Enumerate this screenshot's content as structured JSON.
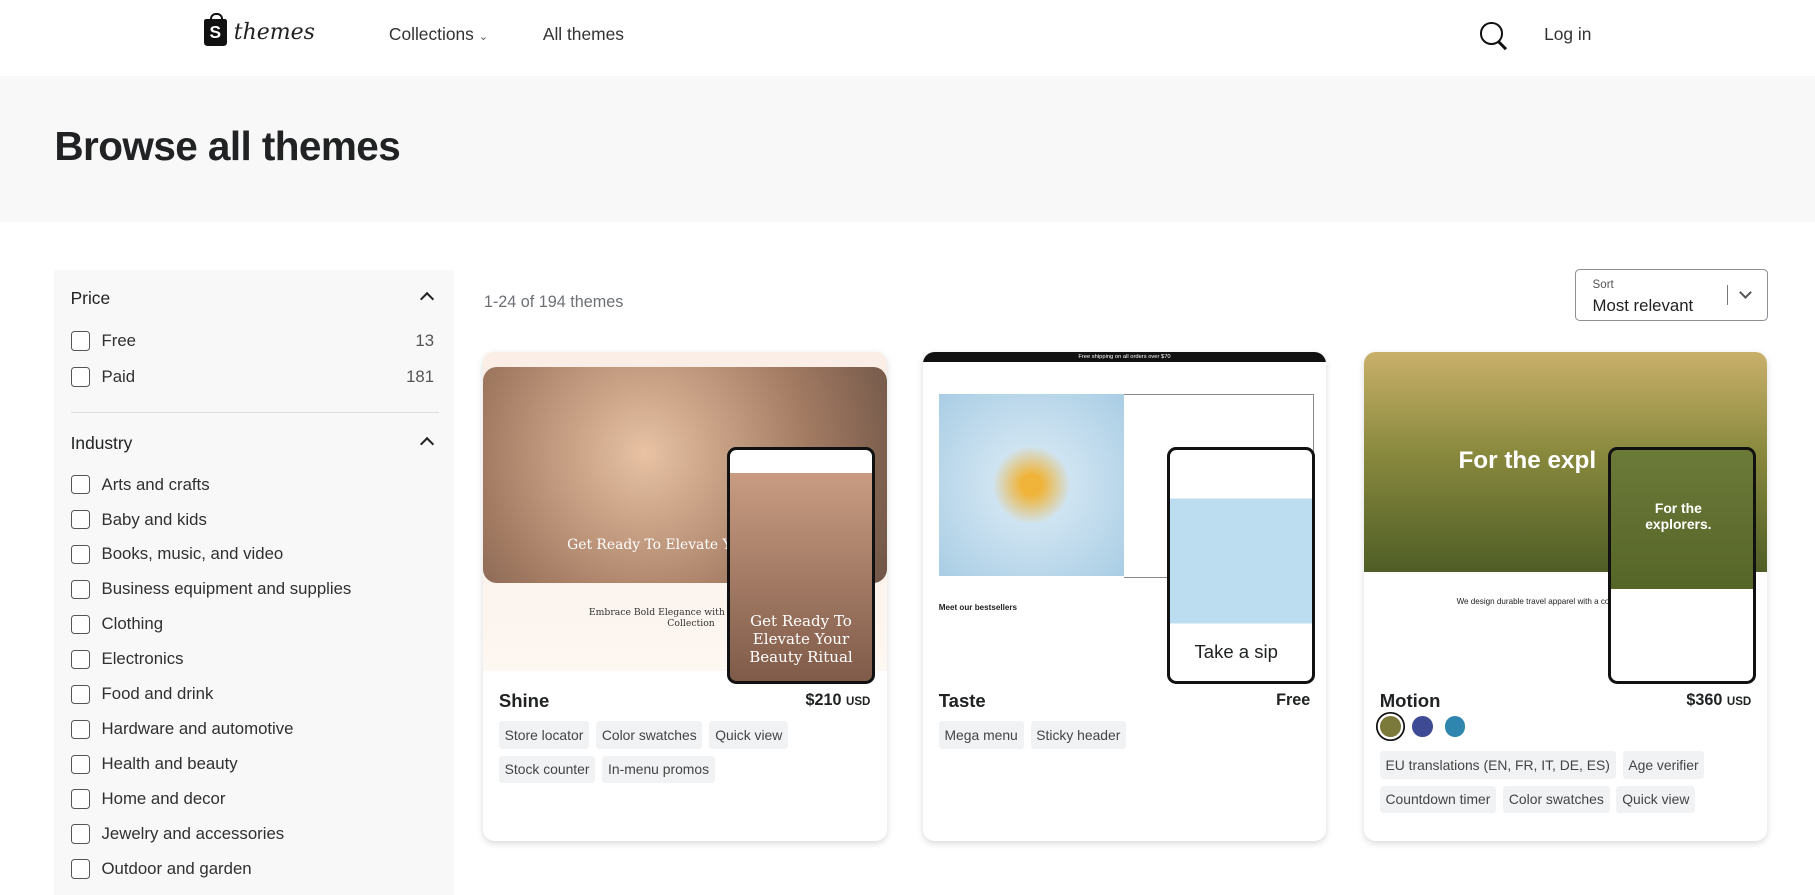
{
  "nav": {
    "logo_text": "themes",
    "collections": "Collections",
    "all_themes": "All themes",
    "login": "Log in"
  },
  "hero": {
    "title": "Browse all themes"
  },
  "filters": {
    "price": {
      "title": "Price",
      "options": [
        {
          "label": "Free",
          "count": "13"
        },
        {
          "label": "Paid",
          "count": "181"
        }
      ]
    },
    "industry": {
      "title": "Industry",
      "options": [
        "Arts and crafts",
        "Baby and kids",
        "Books, music, and video",
        "Business equipment and supplies",
        "Clothing",
        "Electronics",
        "Food and drink",
        "Hardware and automotive",
        "Health and beauty",
        "Home and decor",
        "Jewelry and accessories",
        "Outdoor and garden"
      ]
    }
  },
  "results": {
    "count": "1-24 of 194 themes",
    "sort_label": "Sort",
    "sort_value": "Most relevant"
  },
  "themes": [
    {
      "name": "Shine",
      "price": "$210",
      "currency": "USD",
      "tags": [
        "Store locator",
        "Color swatches",
        "Quick view",
        "Stock counter",
        "In-menu promos"
      ],
      "preview_text": "Get Ready To Elevate Your Beauty Ritual",
      "preview_sub": "Embrace Bold Elegance with Our Exclusive Collection"
    },
    {
      "name": "Taste",
      "price": "Free",
      "currency": "",
      "tags": [
        "Mega menu",
        "Sticky header"
      ],
      "preview_banner": "Free shipping on all orders over $70",
      "preview_text": "Take a sip",
      "preview_sub": "Meet our bestsellers"
    },
    {
      "name": "Motion",
      "price": "$360",
      "currency": "USD",
      "swatches": [
        "#7b7a3a",
        "#3e4a94",
        "#2e86ae"
      ],
      "tags": [
        "EU translations (EN, FR, IT, DE, ES)",
        "Age verifier",
        "Countdown timer",
        "Color swatches",
        "Quick view"
      ],
      "preview_text": "For the explorers.",
      "preview_sub": "We design durable travel apparel with a conscience"
    }
  ]
}
